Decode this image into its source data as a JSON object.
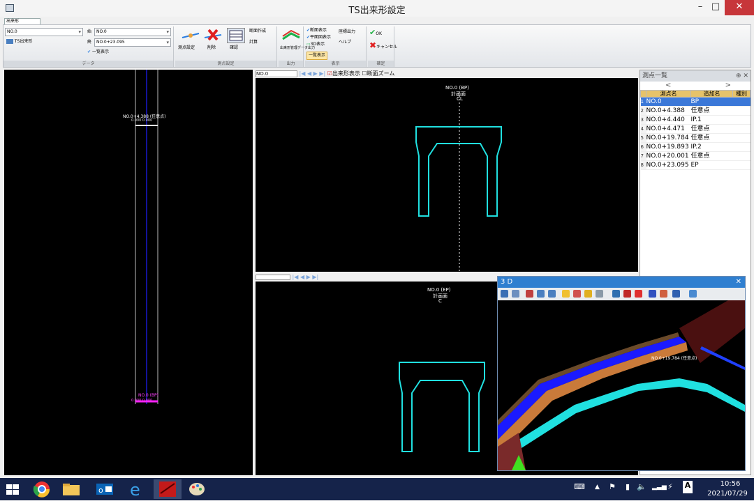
{
  "window": {
    "title": "TS出来形設定",
    "minimize": "–",
    "maximize": "□",
    "close": "✕"
  },
  "ribbon": {
    "tab_label": "出来形",
    "combo1": "NO.0",
    "item1": "TS出来形",
    "combo2_label": "始",
    "combo2": "NO.0",
    "combo3_label": "終",
    "combo3": "NO.0+23.095",
    "check1": "一覧表示",
    "btn_measure": "測点設定",
    "btn_delete": "削除",
    "btn_calc": "確認",
    "small_a": "断面作成",
    "small_b": "計算",
    "btn_export": "出来形管理データ出力",
    "check_a": "断面表示",
    "check_b": "平面図表示",
    "check_c": "3D表示",
    "small_c": "一覧表示",
    "small_d": "座標出力",
    "small_e": "ヘルプ",
    "btn_ok": "OK",
    "btn_cancel": "キャンセル",
    "group_labels": [
      "データ",
      "測点設定",
      "出力",
      "表示",
      "確定"
    ]
  },
  "plan_view": {
    "top_label": "NO.0+4.388 (任意点)",
    "top_sublabel": "0.000 0.000",
    "bottom_label": "NO.0 (BP)",
    "bottom_sublabel": "0.000 0.000"
  },
  "front_view": {
    "toolbar_combo": "NO.0",
    "check_cross": "出来形表示",
    "check_zoom": "断面ズーム",
    "label_station": "NO.0 (BP)",
    "label_sub": "計画面",
    "label_c": "CL"
  },
  "back_view": {
    "label_station": "NO.0 (EP)",
    "label_sub": "計画面",
    "label_c": "C"
  },
  "points_panel": {
    "title": "測点一覧",
    "pin": "⊕",
    "close": "✕",
    "nav_prev": "<",
    "nav_next": ">",
    "columns": [
      "測点名",
      "追加名",
      "種別"
    ],
    "rows": [
      {
        "idx": "1",
        "name": "NO.0",
        "type": "BP"
      },
      {
        "idx": "2",
        "name": "NO.0+4.388",
        "type": "任意点"
      },
      {
        "idx": "3",
        "name": "NO.0+4.440",
        "type": "IP.1"
      },
      {
        "idx": "4",
        "name": "NO.0+4.471",
        "type": "任意点"
      },
      {
        "idx": "5",
        "name": "NO.0+19.784",
        "type": "任意点"
      },
      {
        "idx": "6",
        "name": "NO.0+19.893",
        "type": "IP.2"
      },
      {
        "idx": "7",
        "name": "NO.0+20.001",
        "type": "任意点"
      },
      {
        "idx": "8",
        "name": "NO.0+23.095",
        "type": "EP"
      }
    ]
  },
  "panel_3d": {
    "title": "3 D",
    "close": "✕",
    "label": "NO.0+19.784 (任意点)"
  },
  "taskbar": {
    "time": "10:56",
    "date": "2021/07/29"
  }
}
